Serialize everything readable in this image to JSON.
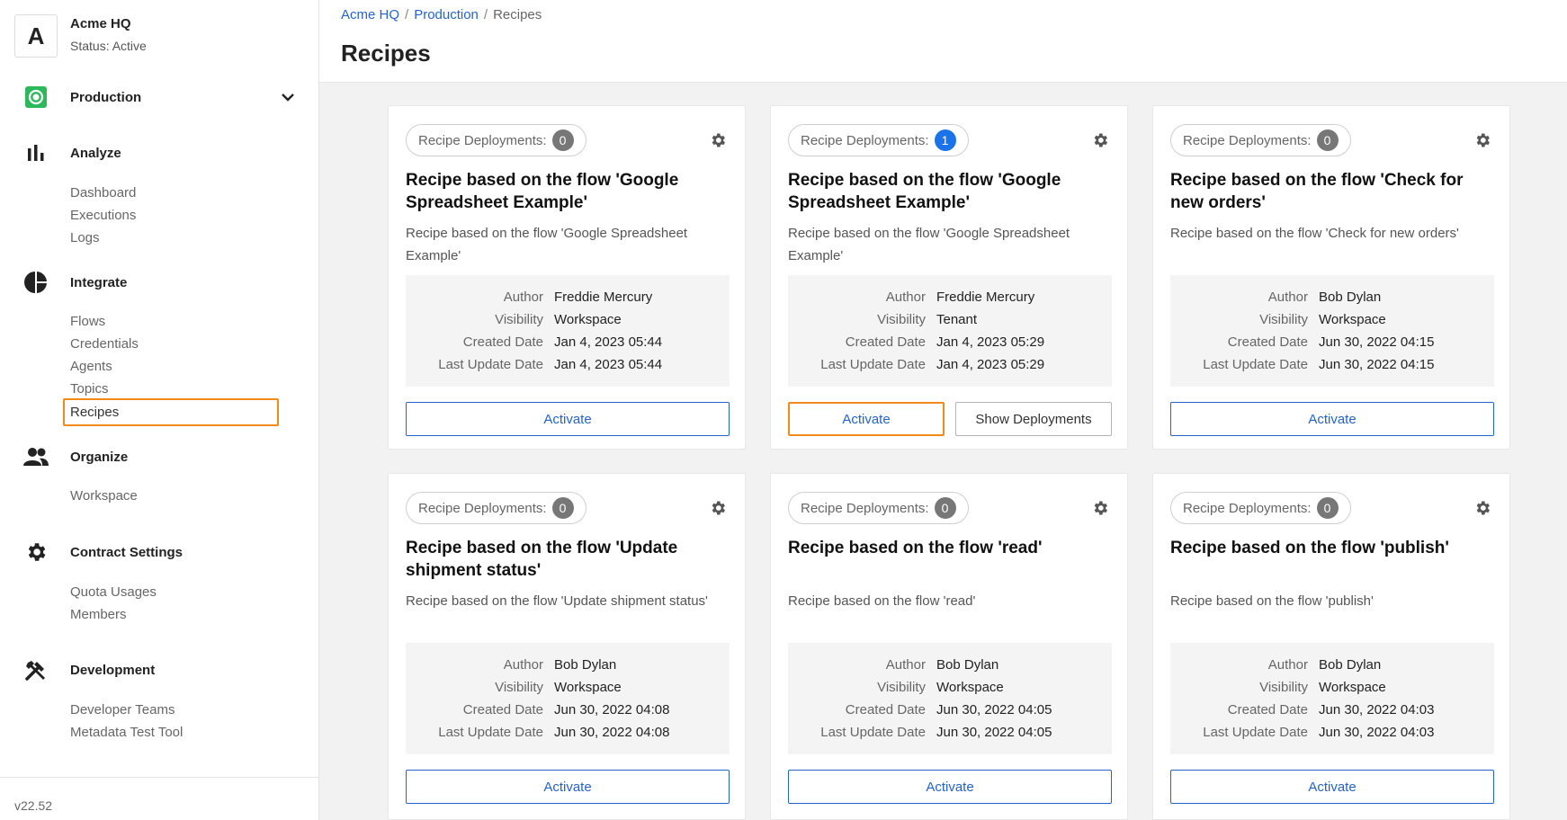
{
  "org": {
    "avatar": "A",
    "name": "Acme HQ",
    "status": "Status: Active"
  },
  "sidebar": {
    "sections": [
      {
        "label": "Production",
        "icon": "production-icon",
        "color": "#2eb85c"
      },
      {
        "label": "Analyze",
        "icon": "bar-chart-icon"
      },
      {
        "label": "Integrate",
        "icon": "pie-chart-icon"
      },
      {
        "label": "Organize",
        "icon": "people-icon"
      },
      {
        "label": "Contract Settings",
        "icon": "gear-icon"
      },
      {
        "label": "Development",
        "icon": "tools-icon"
      }
    ],
    "analyze_items": [
      "Dashboard",
      "Executions",
      "Logs"
    ],
    "integrate_items": [
      "Flows",
      "Credentials",
      "Agents",
      "Topics",
      "Recipes"
    ],
    "organize_items": [
      "Workspace"
    ],
    "contract_items": [
      "Quota Usages",
      "Members"
    ],
    "development_items": [
      "Developer Teams",
      "Metadata Test Tool"
    ],
    "version": "v22.52"
  },
  "breadcrumb": {
    "items": [
      "Acme HQ",
      "Production",
      "Recipes"
    ],
    "separator": "/"
  },
  "page_title": "Recipes",
  "labels": {
    "deployments": "Recipe Deployments:",
    "author": "Author",
    "visibility": "Visibility",
    "created": "Created Date",
    "updated": "Last Update Date",
    "activate": "Activate",
    "show_deployments": "Show Deployments"
  },
  "cards": [
    {
      "count": "0",
      "title": "Recipe based on the flow 'Google Spreadsheet Example'",
      "desc": "Recipe based on the flow 'Google Spreadsheet Example'",
      "author": "Freddie Mercury",
      "visibility": "Workspace",
      "created": "Jan 4, 2023 05:44",
      "updated": "Jan 4, 2023 05:44"
    },
    {
      "count": "1",
      "title": "Recipe based on the flow 'Google Spreadsheet Example'",
      "desc": "Recipe based on the flow 'Google Spreadsheet Example'",
      "author": "Freddie Mercury",
      "visibility": "Tenant",
      "created": "Jan 4, 2023 05:29",
      "updated": "Jan 4, 2023 05:29"
    },
    {
      "count": "0",
      "title": "Recipe based on the flow 'Check for new orders'",
      "desc": "Recipe based on the flow 'Check for new orders'",
      "author": "Bob Dylan",
      "visibility": "Workspace",
      "created": "Jun 30, 2022 04:15",
      "updated": "Jun 30, 2022 04:15"
    },
    {
      "count": "0",
      "title": "Recipe based on the flow 'Update shipment status'",
      "desc": "Recipe based on the flow 'Update shipment status'",
      "author": "Bob Dylan",
      "visibility": "Workspace",
      "created": "Jun 30, 2022 04:08",
      "updated": "Jun 30, 2022 04:08"
    },
    {
      "count": "0",
      "title": "Recipe based on the flow 'read'",
      "desc": "Recipe based on the flow 'read'",
      "author": "Bob Dylan",
      "visibility": "Workspace",
      "created": "Jun 30, 2022 04:05",
      "updated": "Jun 30, 2022 04:05"
    },
    {
      "count": "0",
      "title": "Recipe based on the flow 'publish'",
      "desc": "Recipe based on the flow 'publish'",
      "author": "Bob Dylan",
      "visibility": "Workspace",
      "created": "Jun 30, 2022 04:03",
      "updated": "Jun 30, 2022 04:03"
    }
  ],
  "colors": {
    "accent": "#2563c9",
    "highlight": "#f28a1b",
    "badge_active": "#1a73e8",
    "badge": "#777777"
  }
}
